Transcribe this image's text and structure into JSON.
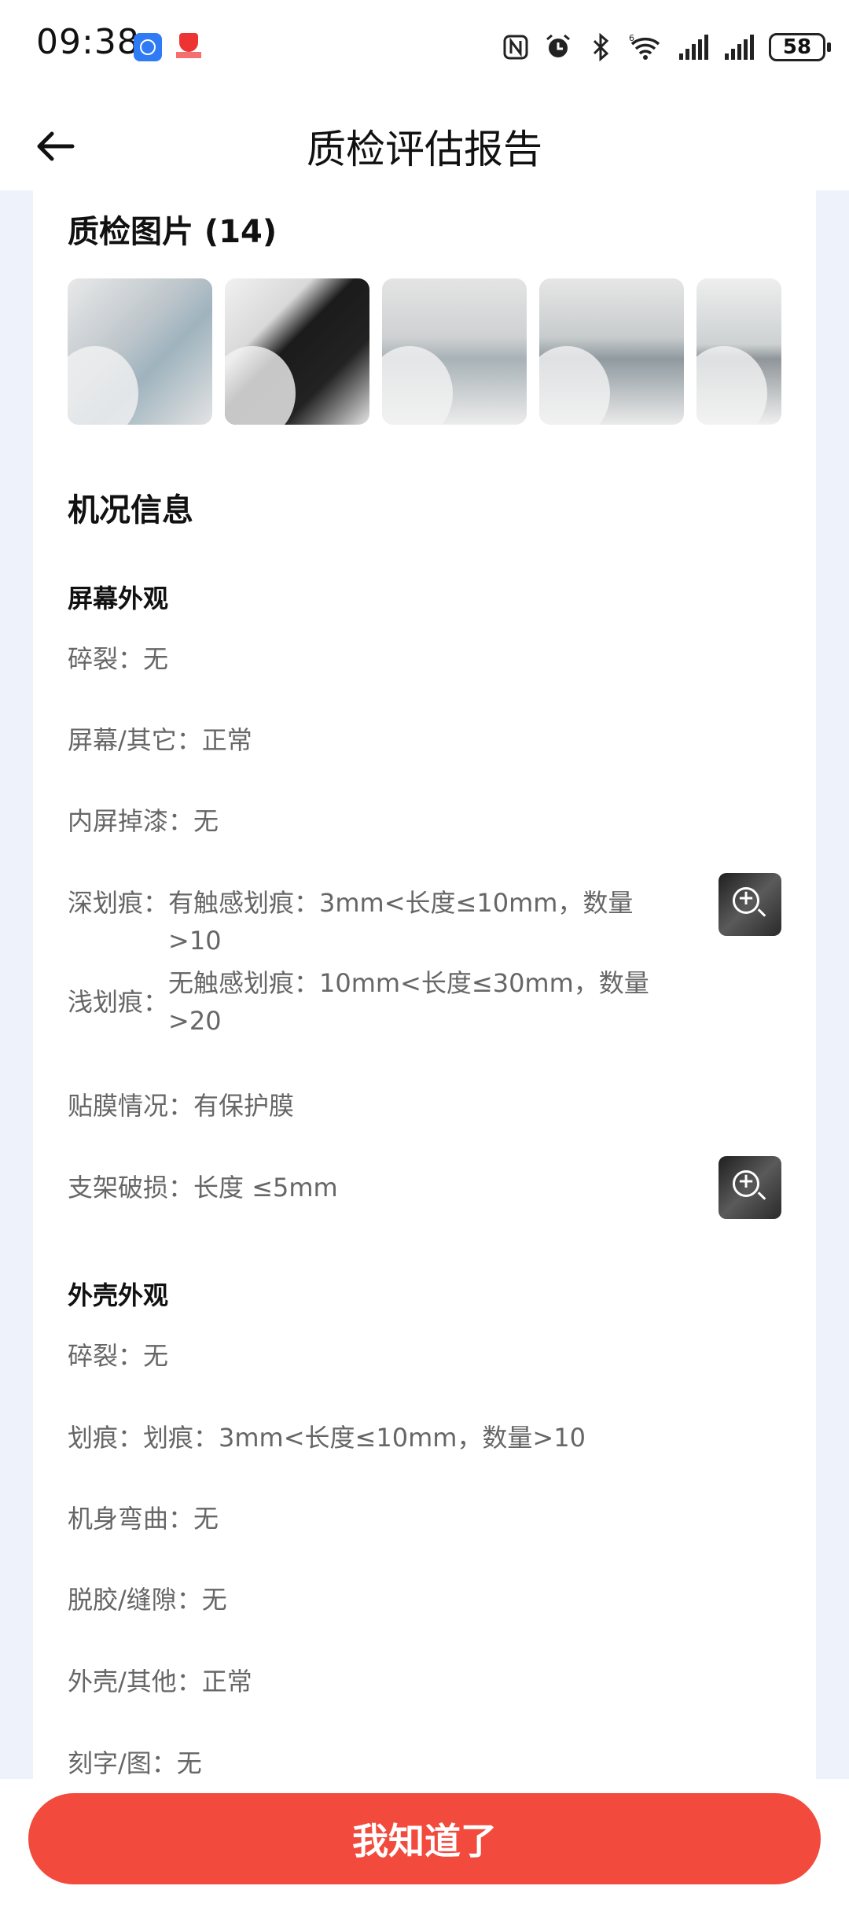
{
  "status_bar": {
    "time": "09:38",
    "battery": "58",
    "icons": [
      "nfc-icon",
      "alarm-icon",
      "bluetooth-icon",
      "wifi-6-icon",
      "signal-icon",
      "signal-icon"
    ]
  },
  "header": {
    "title": "质检评估报告",
    "back_icon": "arrow-left-icon"
  },
  "photos": {
    "title": "质检图片 (14)",
    "count_visible": 5
  },
  "condition": {
    "title": "机况信息",
    "screen": {
      "title": "屏幕外观",
      "items": [
        {
          "k": "碎裂：",
          "v": "无"
        },
        {
          "k": "屏幕/其它：",
          "v": "正常"
        },
        {
          "k": "内屏掉漆：",
          "v": "无"
        },
        {
          "k": "深划痕：",
          "v": "有触感划痕：3mm<长度≤10mm，数量>10",
          "has_photo": true
        },
        {
          "k": "浅划痕：",
          "v": "无触感划痕：10mm<长度≤30mm，数量>20"
        },
        {
          "k": "贴膜情况：",
          "v": "有保护膜"
        },
        {
          "k": "支架破损：",
          "v": "长度 ≤5mm",
          "has_photo": true
        }
      ]
    },
    "shell": {
      "title": "外壳外观",
      "items": [
        {
          "k": "碎裂：",
          "v": "无"
        },
        {
          "k": "划痕：",
          "v": "划痕：3mm<长度≤10mm，数量>10"
        },
        {
          "k": "机身弯曲：",
          "v": "无"
        },
        {
          "k": "脱胶/缝隙：",
          "v": "无"
        },
        {
          "k": "外壳/其他：",
          "v": "正常"
        },
        {
          "k": "刻字/图：",
          "v": "无"
        }
      ]
    }
  },
  "footer": {
    "button_label": "我知道了",
    "button_color": "#f24a3d"
  }
}
